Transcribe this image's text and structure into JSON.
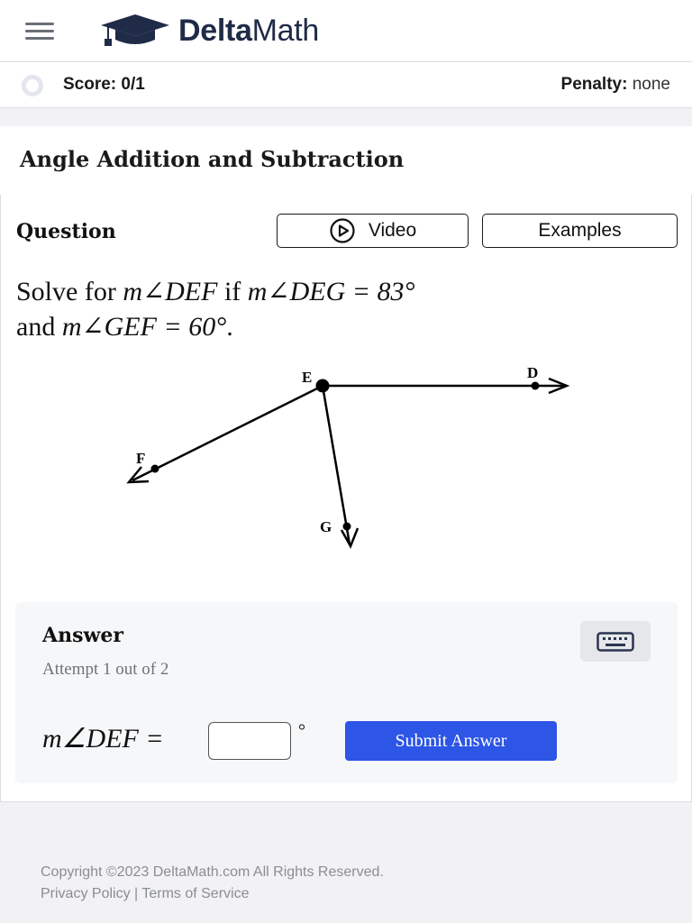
{
  "app": {
    "brand_bold": "Delta",
    "brand_light": "Math"
  },
  "scorebar": {
    "score": "Score: 0/1",
    "penalty_label": "Penalty:",
    "penalty_value": "none"
  },
  "page": {
    "title": "Angle Addition and Subtraction"
  },
  "question": {
    "label": "Question",
    "video_label": "Video",
    "examples_label": "Examples",
    "prompt_part1": "Solve for ",
    "prompt_expr1": "m∠DEF",
    "prompt_part2": " if ",
    "prompt_expr2": "m∠DEG = 83°",
    "prompt_part3": " and ",
    "prompt_expr3": "m∠GEF = 60°",
    "prompt_end": "."
  },
  "diagram": {
    "points": {
      "E": "E",
      "D": "D",
      "F": "F",
      "G": "G"
    }
  },
  "answer": {
    "title": "Answer",
    "attempt": "Attempt 1 out of 2",
    "label": "m∠DEF =",
    "input_value": "",
    "unit": "°",
    "submit_label": "Submit Answer"
  },
  "footer": {
    "copyright": "Copyright ©2023 DeltaMath.com All Rights Reserved.",
    "privacy": "Privacy Policy",
    "separator": "|",
    "terms": "Terms of Service"
  },
  "colors": {
    "accent": "#2d55e6",
    "brand": "#1f2b47"
  },
  "icons": {
    "menu": "hamburger-icon",
    "logo": "graduation-cap-icon",
    "video": "play-circle-icon",
    "keyboard": "keyboard-icon"
  }
}
